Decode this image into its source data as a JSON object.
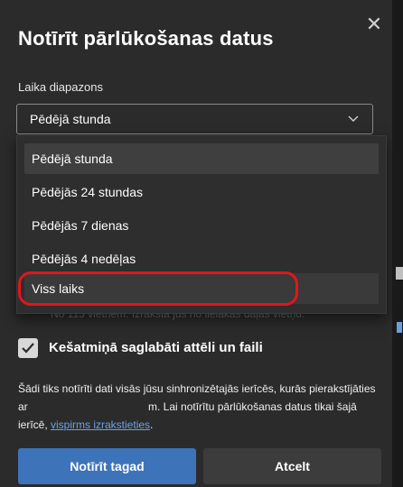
{
  "dialog": {
    "title": "Notīrīt pārlūkošanas datus",
    "close_icon": "close-icon"
  },
  "time_range": {
    "label": "Laika diapazons",
    "selected": "Pēdējā stunda",
    "options": [
      "Pēdējā stunda",
      "Pēdējās 24 stundas",
      "Pēdējās 7 dienas",
      "Pēdējās 4 nedēļas",
      "Viss laiks"
    ],
    "highlighted_index": 4
  },
  "partially_hidden_text": "No 113 vietnēm. Izraksta jūs no lielākās daļas vietņu.",
  "cached_images": {
    "checked": true,
    "label": "Kešatmiņā saglabāti attēli un faili"
  },
  "info": {
    "part1": "Šādi tiks notīrīti dati visās jūsu sinhronizētajās ierīcēs, kurās pierakstījāties ar ",
    "part2": "m. Lai notīrītu pārlūkošanas datus tikai šajā ierīcē, ",
    "link": "vispirms izrakstieties",
    "part3": "."
  },
  "buttons": {
    "clear_now": "Notīrīt tagad",
    "cancel": "Atcelt"
  },
  "colors": {
    "background": "#2b2b2b",
    "primary_button": "#3d73b8",
    "link": "#6aa4e8",
    "annotation_red": "#e0161c"
  }
}
